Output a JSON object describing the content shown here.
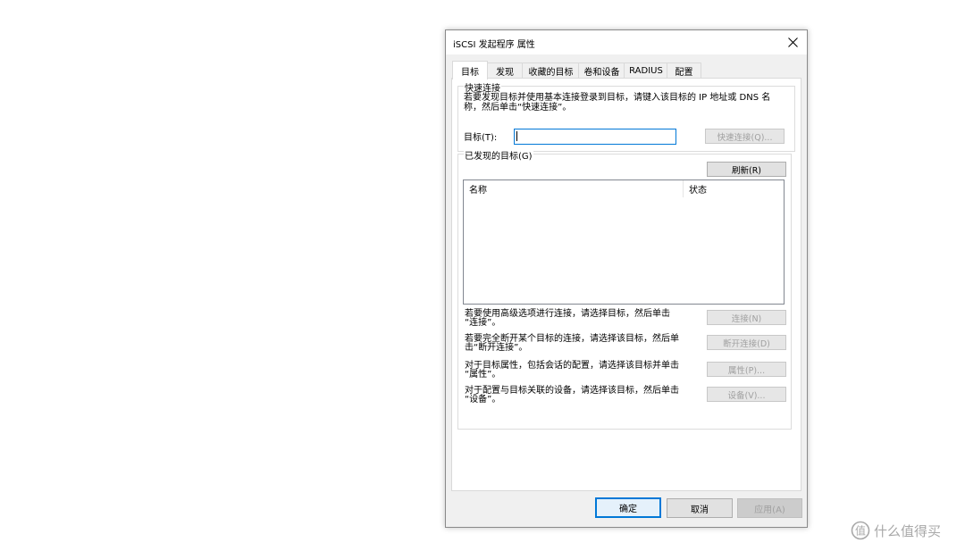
{
  "dialog": {
    "title": "iSCSI 发起程序 属性",
    "close_icon": "close-icon"
  },
  "tabs": [
    {
      "label": "目标",
      "active": true
    },
    {
      "label": "发现",
      "active": false
    },
    {
      "label": "收藏的目标",
      "active": false
    },
    {
      "label": "卷和设备",
      "active": false
    },
    {
      "label": "RADIUS",
      "active": false
    },
    {
      "label": "配置",
      "active": false
    }
  ],
  "quick_connect": {
    "legend": "快速连接",
    "description_line1": "若要发现目标并使用基本连接登录到目标，请键入该目标的 IP 地址或 DNS 名",
    "description_line2": "称，然后单击“快速连接”。",
    "target_label": "目标(T):",
    "target_value": "",
    "button": "快速连接(Q)..."
  },
  "discovered": {
    "legend": "已发现的目标(G)",
    "refresh_button": "刷新(R)",
    "columns": [
      "名称",
      "状态"
    ],
    "rows": []
  },
  "actions": [
    {
      "line1": "若要使用高级选项进行连接，请选择目标，然后单击",
      "line2": "“连接”。",
      "button": "连接(N)"
    },
    {
      "line1": "若要完全断开某个目标的连接，请选择该目标，然后单",
      "line2": "击“断开连接”。",
      "button": "断开连接(D)"
    },
    {
      "line1": "对于目标属性，包括会话的配置，请选择该目标并单击",
      "line2": "“属性”。",
      "button": "属性(P)..."
    },
    {
      "line1": "对于配置与目标关联的设备，请选择该目标，然后单击",
      "line2": "“设备”。",
      "button": "设备(V)..."
    }
  ],
  "footer": {
    "ok": "确定",
    "cancel": "取消",
    "apply": "应用(A)"
  },
  "watermark": {
    "text": "什么值得买",
    "icon": "zhi-logo-icon"
  }
}
